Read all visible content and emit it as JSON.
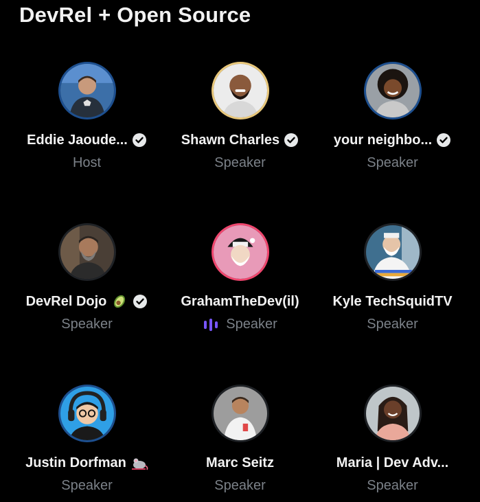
{
  "space": {
    "title": "DevRel + Open Source"
  },
  "participants": [
    {
      "name": "Eddie Jaoude...",
      "role": "Host",
      "verified": true,
      "avatar_icon": "avatar-eddie"
    },
    {
      "name": "Shawn Charles",
      "role": "Speaker",
      "verified": true,
      "avatar_icon": "avatar-shawn"
    },
    {
      "name": "your neighbo...",
      "role": "Speaker",
      "verified": true,
      "avatar_icon": "avatar-neighbor"
    },
    {
      "name": "DevRel Dojo",
      "role": "Speaker",
      "verified": true,
      "emoji_icon": "avocado-icon",
      "avatar_icon": "avatar-dojo"
    },
    {
      "name": "GrahamTheDev(il)",
      "role": "Speaker",
      "verified": false,
      "speaking": true,
      "avatar_icon": "avatar-graham"
    },
    {
      "name": "Kyle TechSquidTV",
      "role": "Speaker",
      "verified": false,
      "avatar_icon": "avatar-kyle"
    },
    {
      "name": "Justin Dorfman",
      "role": "Speaker",
      "verified": false,
      "emoji_icon": "mouse-icon",
      "avatar_icon": "avatar-justin"
    },
    {
      "name": "Marc Seitz",
      "role": "Speaker",
      "verified": false,
      "avatar_icon": "avatar-marc"
    },
    {
      "name": "Maria | Dev Adv...",
      "role": "Speaker",
      "verified": false,
      "avatar_icon": "avatar-maria"
    }
  ],
  "colors": {
    "background": "#000000",
    "name_text": "#f2f2f2",
    "role_text": "#7b8188",
    "speaking_indicator": "#7856ff"
  }
}
